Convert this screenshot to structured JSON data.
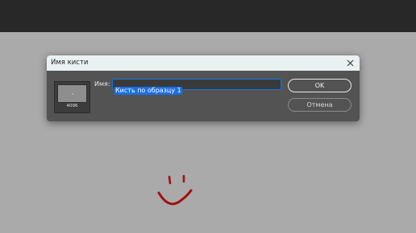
{
  "dialog": {
    "title": "Имя кисти",
    "name_label": "Имя:",
    "name_value": "Кисть по образцу 1",
    "brush_size": "4096",
    "ok_label": "OK",
    "cancel_label": "Отмена"
  },
  "icons": {
    "close": "close-icon"
  },
  "colors": {
    "accent": "#1473e6",
    "smiley": "#a30f0f"
  }
}
